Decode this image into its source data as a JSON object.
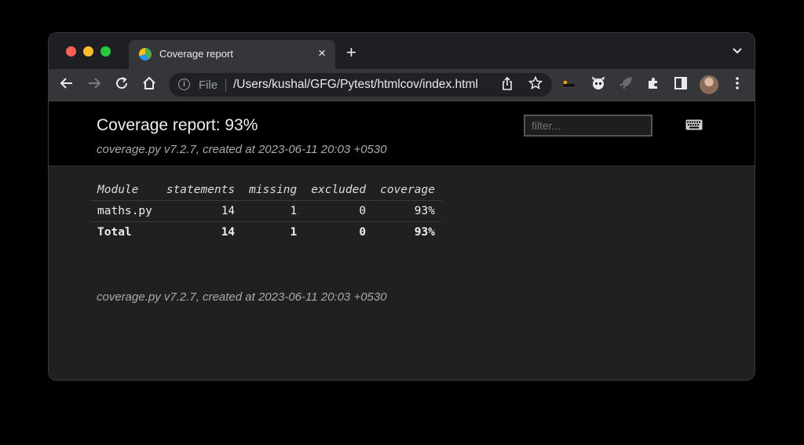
{
  "browser": {
    "tab_title": "Coverage report",
    "tab_close": "×",
    "new_tab": "+",
    "tab_menu": "⌄",
    "omnibox_scheme": "File",
    "url": "/Users/kushal/GFG/Pytest/htmlcov/index.html",
    "colors": {
      "red": "#ff5f57",
      "yellow": "#febc2e",
      "green": "#28c840"
    },
    "icons": {
      "back": "back-arrow-icon",
      "forward": "forward-arrow-icon",
      "reload": "reload-icon",
      "home": "home-icon",
      "info": "info-icon",
      "share": "share-icon",
      "bookmark": "star-icon",
      "extensions": [
        "extension-icon-1",
        "extension-icon-2",
        "rocket-extension-icon",
        "puzzle-extensions-icon",
        "sidepanel-icon",
        "avatar",
        "kebab-menu-icon"
      ]
    }
  },
  "report": {
    "title": "Coverage report: 93%",
    "subtitle": "coverage.py v7.2.7, created at 2023-06-11 20:03 +0530",
    "filter_placeholder": "filter...",
    "columns": [
      "Module",
      "statements",
      "missing",
      "excluded",
      "coverage"
    ],
    "rows": [
      {
        "module": "maths.py",
        "statements": "14",
        "missing": "1",
        "excluded": "0",
        "coverage": "93%"
      }
    ],
    "total": {
      "module": "Total",
      "statements": "14",
      "missing": "1",
      "excluded": "0",
      "coverage": "93%"
    },
    "footer": "coverage.py v7.2.7, created at 2023-06-11 20:03 +0530"
  }
}
